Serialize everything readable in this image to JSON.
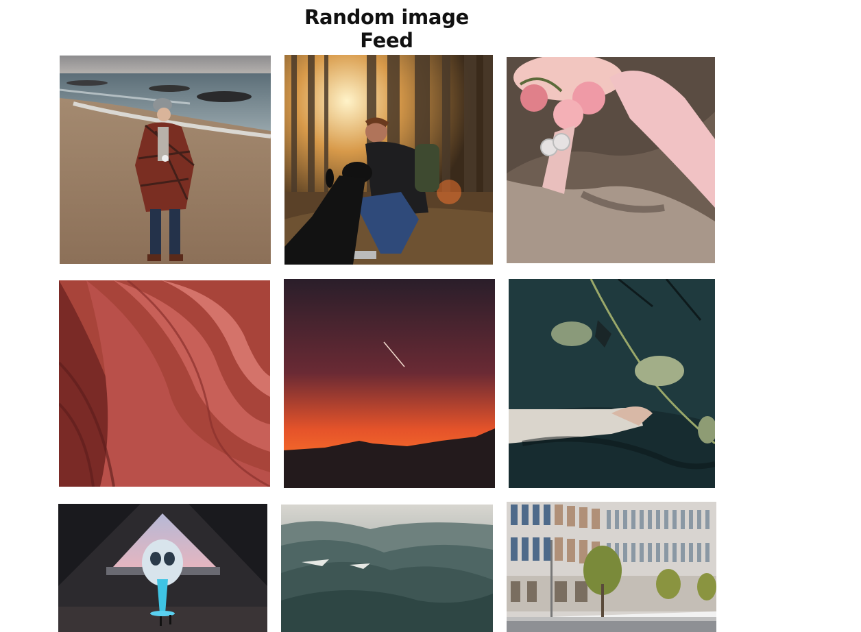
{
  "header": {
    "title": "Random image Feed"
  },
  "feed": {
    "images": [
      {
        "subject": "woman on beach"
      },
      {
        "subject": "man with dog in forest"
      },
      {
        "subject": "pink ribbon with rings on rock"
      },
      {
        "subject": "red abstract waves"
      },
      {
        "subject": "sunset over mountains"
      },
      {
        "subject": "hand in water with lily pads"
      },
      {
        "subject": "futuristic hall with sculpture"
      },
      {
        "subject": "aerial mountain range"
      },
      {
        "subject": "modern building with trees"
      }
    ]
  }
}
